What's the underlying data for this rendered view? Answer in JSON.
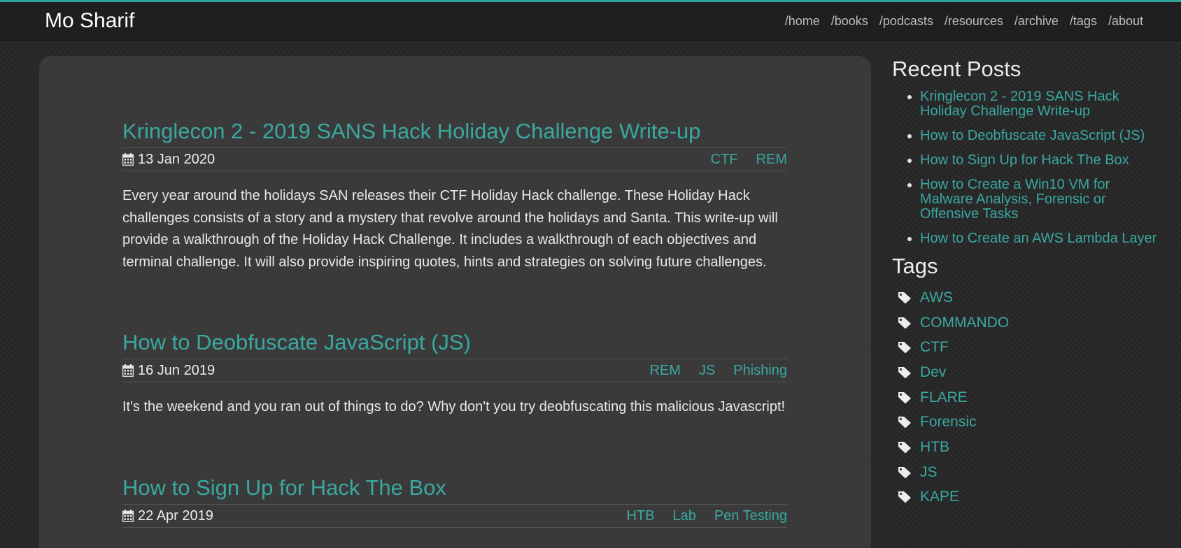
{
  "header": {
    "brand": "Mo Sharif",
    "nav": [
      "/home",
      "/books",
      "/podcasts",
      "/resources",
      "/archive",
      "/tags",
      "/about"
    ]
  },
  "posts": [
    {
      "title": "Kringlecon 2 - 2019 SANS Hack Holiday Challenge Write-up",
      "date": "13 Jan 2020",
      "tags": [
        "CTF",
        "REM"
      ],
      "excerpt": "Every year around the holidays SAN releases their CTF Holiday Hack challenge. These Holiday Hack challenges consists of a story and a mystery that revolve around the holidays and Santa. This write-up will provide a walkthrough of the Holiday Hack Challenge. It includes a walkthrough of each objectives and terminal challenge. It will also provide inspiring quotes, hints and strategies on solving future challenges."
    },
    {
      "title": "How to Deobfuscate JavaScript (JS)",
      "date": "16 Jun 2019",
      "tags": [
        "REM",
        "JS",
        "Phishing"
      ],
      "excerpt": "It's the weekend and you ran out of things to do? Why don't you try deobfuscating this malicious Javascript!"
    },
    {
      "title": "How to Sign Up for Hack The Box",
      "date": "22 Apr 2019",
      "tags": [
        "HTB",
        "Lab",
        "Pen Testing"
      ]
    }
  ],
  "sidebar": {
    "recent_title": "Recent Posts",
    "recent": [
      "Kringlecon 2 - 2019 SANS Hack Holiday Challenge Write-up",
      "How to Deobfuscate JavaScript (JS)",
      "How to Sign Up for Hack The Box",
      "How to Create a Win10 VM for Malware Analysis, Forensic or Offensive Tasks",
      "How to Create an AWS Lambda Layer"
    ],
    "tags_title": "Tags",
    "tags": [
      "AWS",
      "COMMANDO",
      "CTF",
      "Dev",
      "FLARE",
      "Forensic",
      "HTB",
      "JS",
      "KAPE"
    ]
  },
  "icons": {
    "date": "calendar-icon",
    "tag": "tag-icon"
  },
  "colors": {
    "accent": "#2fa39a",
    "link": "#3aa8a0",
    "card": "#3a3a3a",
    "header": "#1f1f1f"
  }
}
